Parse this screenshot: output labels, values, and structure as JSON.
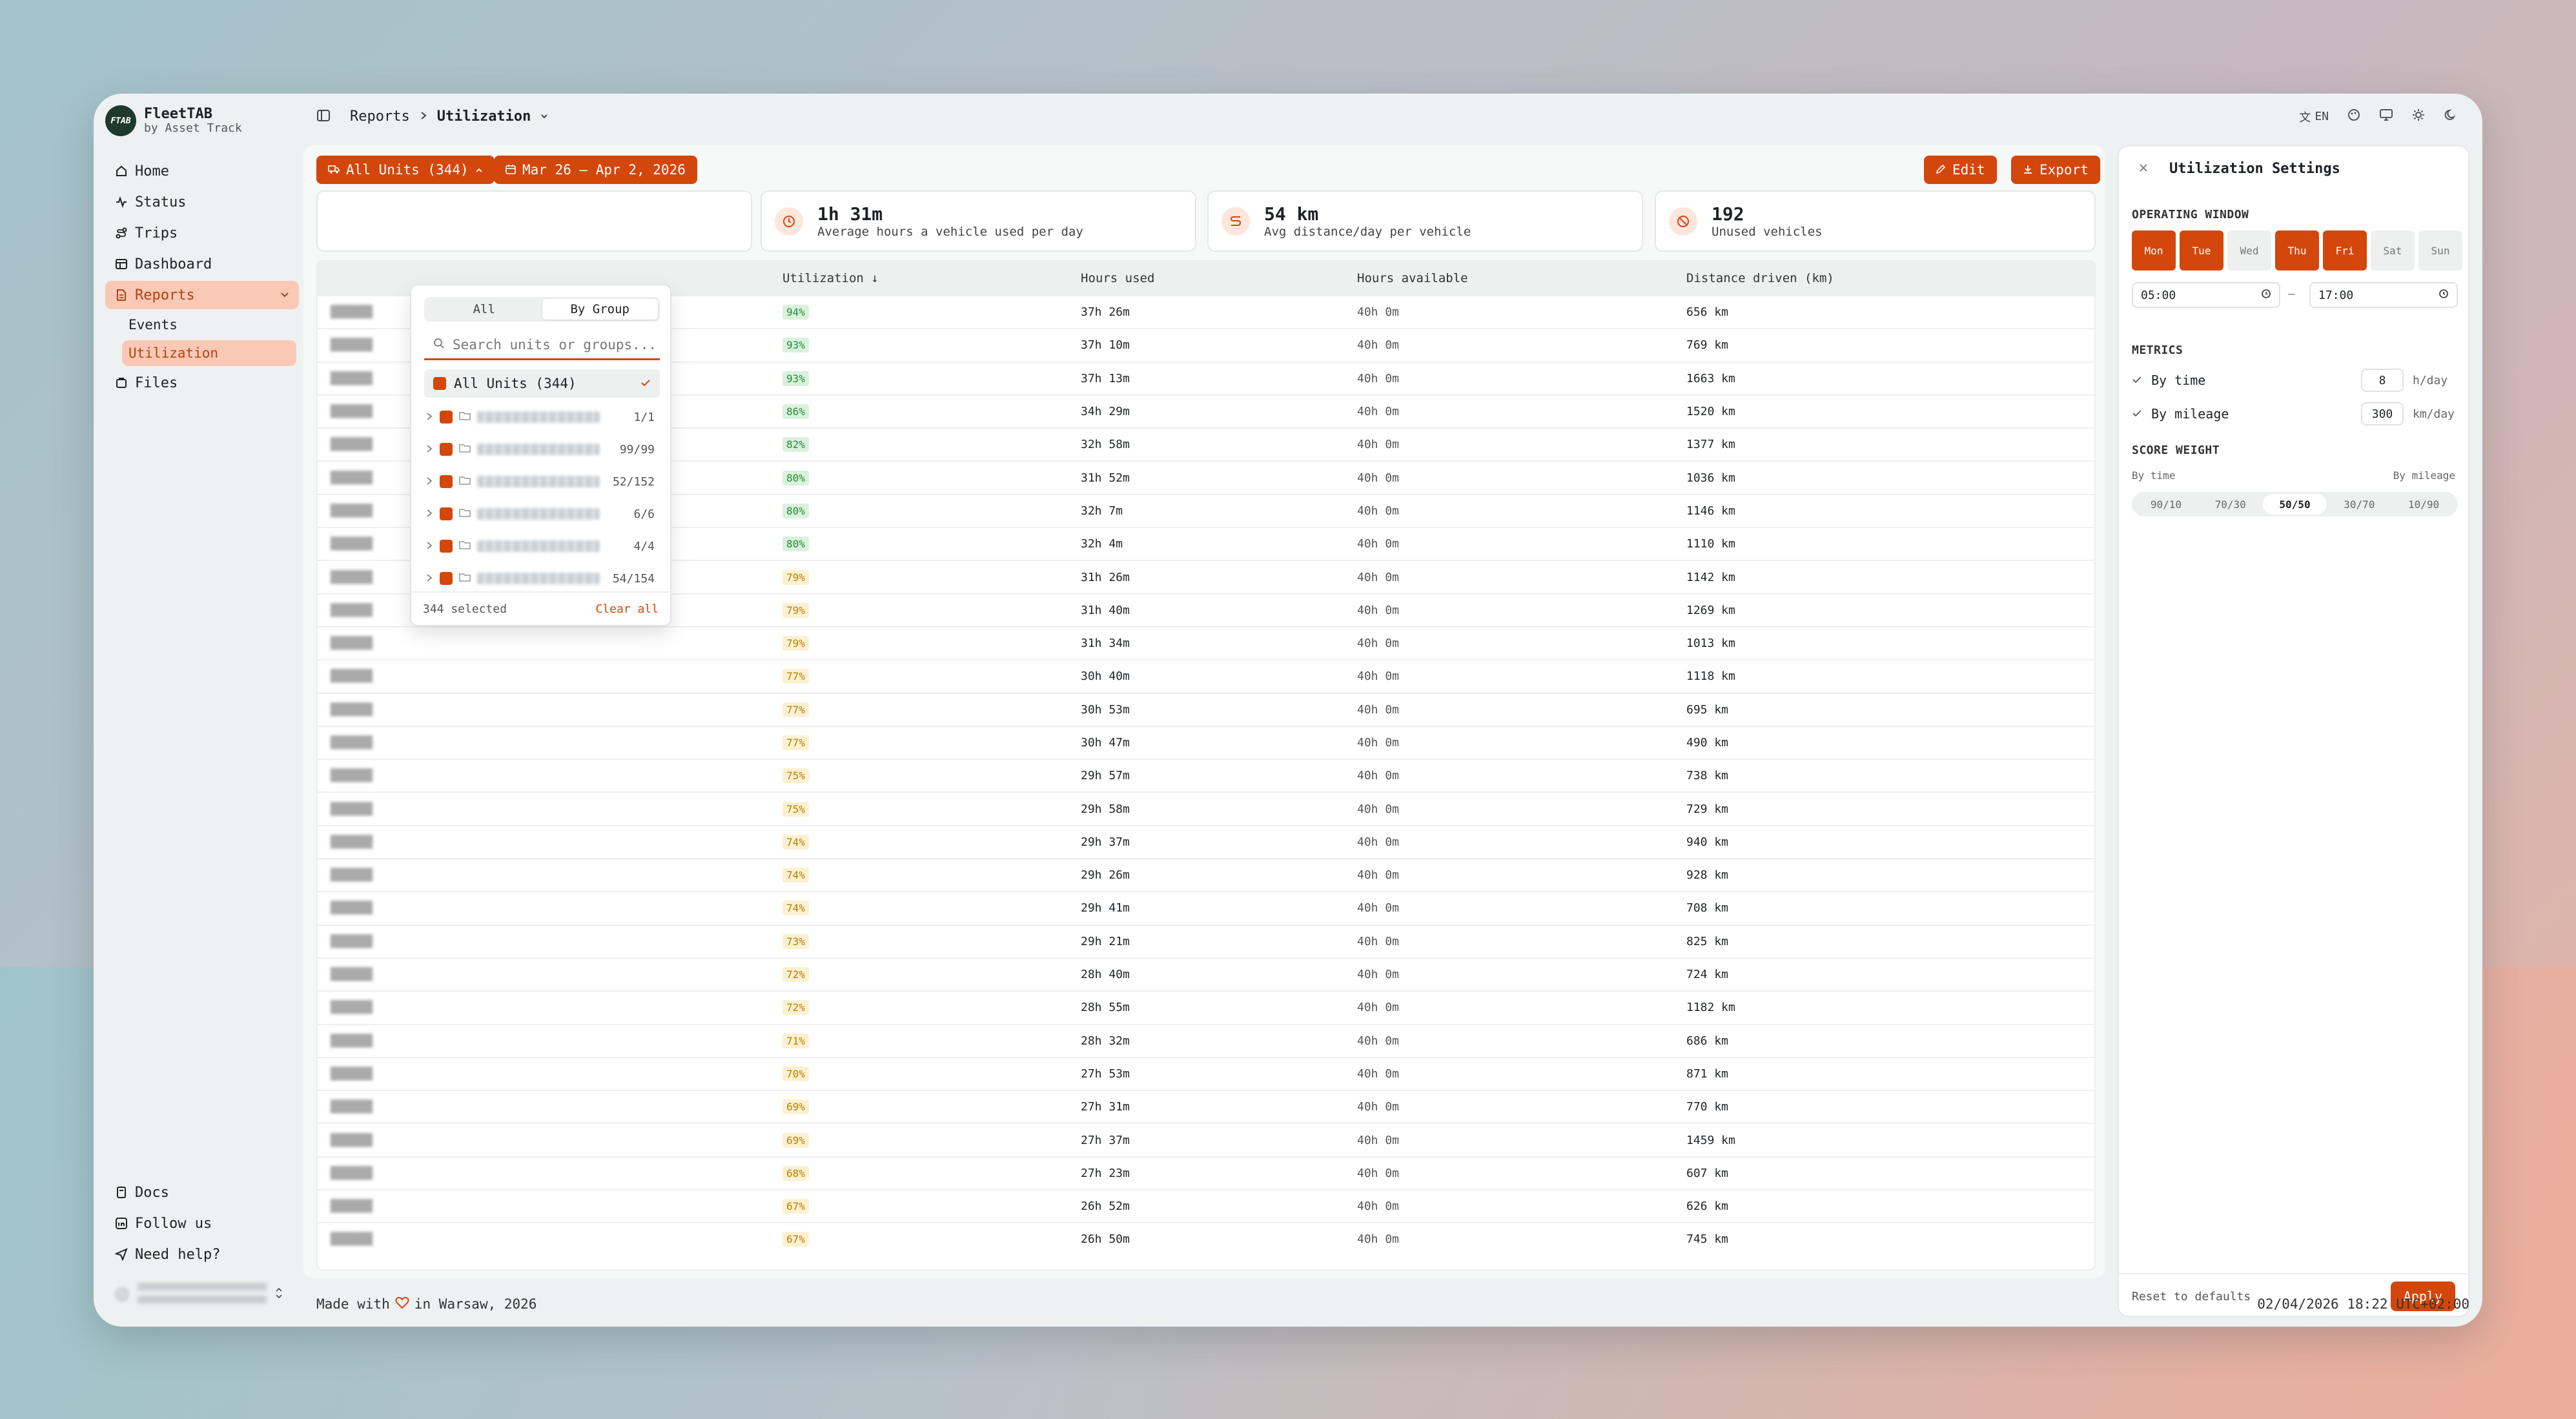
{
  "brand": {
    "name": "FleetTAB",
    "sub": "by Asset Track",
    "logo": "FTAB"
  },
  "nav": {
    "items": [
      {
        "label": "Home",
        "icon": "home-icon"
      },
      {
        "label": "Status",
        "icon": "activity-icon"
      },
      {
        "label": "Trips",
        "icon": "route-icon"
      },
      {
        "label": "Dashboard",
        "icon": "dashboard-icon"
      },
      {
        "label": "Reports",
        "icon": "report-icon"
      }
    ],
    "sub": [
      {
        "label": "Events"
      },
      {
        "label": "Utilization"
      }
    ],
    "files": "Files",
    "bottom": [
      {
        "label": "Docs"
      },
      {
        "label": "Follow us"
      },
      {
        "label": "Need help?"
      }
    ]
  },
  "topbar": {
    "crumb_parent": "Reports",
    "crumb_current": "Utilization",
    "lang": "EN"
  },
  "toolbar": {
    "units": "All Units (344)",
    "range": "Mar 26 – Apr 2, 2026",
    "edit": "Edit",
    "export": "Export"
  },
  "stats": [
    {
      "value": "1h 31m",
      "label": "Average hours a vehicle used per day"
    },
    {
      "value": "54 km",
      "label": "Avg distance/day per vehicle"
    },
    {
      "value": "192",
      "label": "Unused vehicles"
    }
  ],
  "table": {
    "headers": [
      "Utilization ↓",
      "Hours used",
      "Hours available",
      "Distance driven (km)"
    ],
    "rows": [
      [
        "94%",
        "37h 26m",
        "40h 0m",
        "656 km",
        "g"
      ],
      [
        "93%",
        "37h 10m",
        "40h 0m",
        "769 km",
        "g"
      ],
      [
        "93%",
        "37h 13m",
        "40h 0m",
        "1663 km",
        "g"
      ],
      [
        "86%",
        "34h 29m",
        "40h 0m",
        "1520 km",
        "g"
      ],
      [
        "82%",
        "32h 58m",
        "40h 0m",
        "1377 km",
        "g"
      ],
      [
        "80%",
        "31h 52m",
        "40h 0m",
        "1036 km",
        "g"
      ],
      [
        "80%",
        "32h 7m",
        "40h 0m",
        "1146 km",
        "g"
      ],
      [
        "80%",
        "32h 4m",
        "40h 0m",
        "1110 km",
        "g"
      ],
      [
        "79%",
        "31h 26m",
        "40h 0m",
        "1142 km",
        "y"
      ],
      [
        "79%",
        "31h 40m",
        "40h 0m",
        "1269 km",
        "y"
      ],
      [
        "79%",
        "31h 34m",
        "40h 0m",
        "1013 km",
        "y"
      ],
      [
        "77%",
        "30h 40m",
        "40h 0m",
        "1118 km",
        "y"
      ],
      [
        "77%",
        "30h 53m",
        "40h 0m",
        "695 km",
        "y"
      ],
      [
        "77%",
        "30h 47m",
        "40h 0m",
        "490 km",
        "y"
      ],
      [
        "75%",
        "29h 57m",
        "40h 0m",
        "738 km",
        "y"
      ],
      [
        "75%",
        "29h 58m",
        "40h 0m",
        "729 km",
        "y"
      ],
      [
        "74%",
        "29h 37m",
        "40h 0m",
        "940 km",
        "y"
      ],
      [
        "74%",
        "29h 26m",
        "40h 0m",
        "928 km",
        "y"
      ],
      [
        "74%",
        "29h 41m",
        "40h 0m",
        "708 km",
        "y"
      ],
      [
        "73%",
        "29h 21m",
        "40h 0m",
        "825 km",
        "y"
      ],
      [
        "72%",
        "28h 40m",
        "40h 0m",
        "724 km",
        "y"
      ],
      [
        "72%",
        "28h 55m",
        "40h 0m",
        "1182 km",
        "y"
      ],
      [
        "71%",
        "28h 32m",
        "40h 0m",
        "686 km",
        "y"
      ],
      [
        "70%",
        "27h 53m",
        "40h 0m",
        "871 km",
        "y"
      ],
      [
        "69%",
        "27h 31m",
        "40h 0m",
        "770 km",
        "y"
      ],
      [
        "69%",
        "27h 37m",
        "40h 0m",
        "1459 km",
        "y"
      ],
      [
        "68%",
        "27h 23m",
        "40h 0m",
        "607 km",
        "y"
      ],
      [
        "67%",
        "26h 52m",
        "40h 0m",
        "626 km",
        "y"
      ],
      [
        "67%",
        "26h 50m",
        "40h 0m",
        "745 km",
        "y"
      ]
    ]
  },
  "dropdown": {
    "tab_all": "All",
    "tab_group": "By Group",
    "search_placeholder": "Search units or groups...",
    "all_label": "All Units (344)",
    "groups": [
      "1/1",
      "99/99",
      "52/152",
      "6/6",
      "4/4",
      "54/154"
    ],
    "selected": "344 selected",
    "clear": "Clear all"
  },
  "settings": {
    "title": "Utilization Settings",
    "operating": "OPERATING WINDOW",
    "days": [
      {
        "d": "Mon",
        "on": true
      },
      {
        "d": "Tue",
        "on": true
      },
      {
        "d": "Wed",
        "on": false
      },
      {
        "d": "Thu",
        "on": true
      },
      {
        "d": "Fri",
        "on": true
      },
      {
        "d": "Sat",
        "on": false
      },
      {
        "d": "Sun",
        "on": false
      }
    ],
    "from": "05:00",
    "to": "17:00",
    "dash": "–",
    "metrics_title": "METRICS",
    "by_time": "By time",
    "time_val": "8",
    "time_unit": "h/day",
    "by_mileage": "By mileage",
    "mileage_val": "300",
    "mileage_unit": "km/day",
    "weight_title": "SCORE WEIGHT",
    "w_left": "By time",
    "w_right": "By mileage",
    "weights": [
      "90/10",
      "70/30",
      "50/50",
      "30/70",
      "10/90"
    ],
    "weight_selected": "50/50",
    "reset": "Reset to defaults",
    "apply": "Apply"
  },
  "footer": {
    "made": "Made with",
    "place": "in Warsaw, 2026",
    "datetime": "02/04/2026 18:22 UTC+02:00"
  },
  "colors": {
    "accent": "#d4470c",
    "good": "#2c8a3a",
    "warn": "#b98100"
  }
}
